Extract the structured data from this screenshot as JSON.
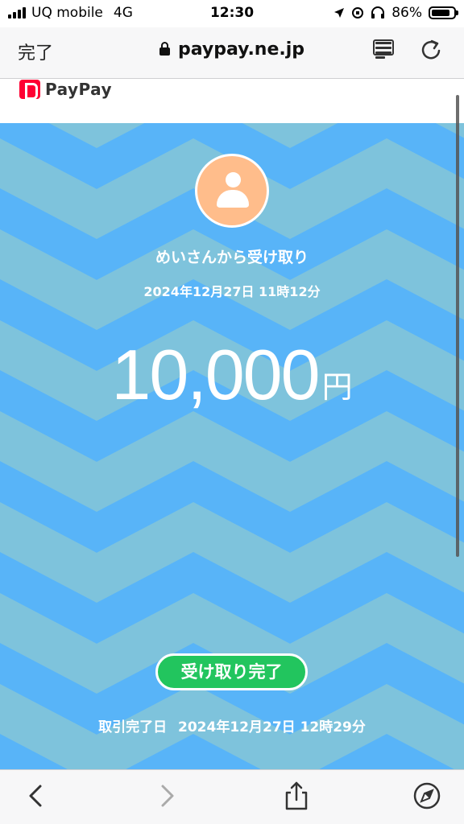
{
  "status_bar": {
    "carrier": "UQ mobile",
    "network": "4G",
    "time": "12:30",
    "battery_percent": "86%",
    "battery_level": 0.86
  },
  "browser": {
    "done_label": "完了",
    "url": "paypay.ne.jp"
  },
  "brand": {
    "name": "PayPay"
  },
  "transaction": {
    "sender_text": "めいさんから受け取り",
    "datetime": "2024年12月27日 11時12分",
    "amount": "10,000",
    "currency_unit": "円",
    "status_badge": "受け取り完了",
    "completed_label": "取引完了日",
    "completed_datetime": "2024年12月27日 12時29分"
  },
  "colors": {
    "background_blue": "#58b4f8",
    "zigzag": "#7ec3dc",
    "avatar": "#ffbd8b",
    "badge_green": "#22c55e",
    "paypay_red": "#ff0033"
  },
  "icons": {
    "navbar": [
      "lock-icon",
      "reader-icon",
      "reload-icon"
    ],
    "toolbar": [
      "back-icon",
      "forward-icon",
      "share-icon",
      "compass-icon"
    ]
  }
}
